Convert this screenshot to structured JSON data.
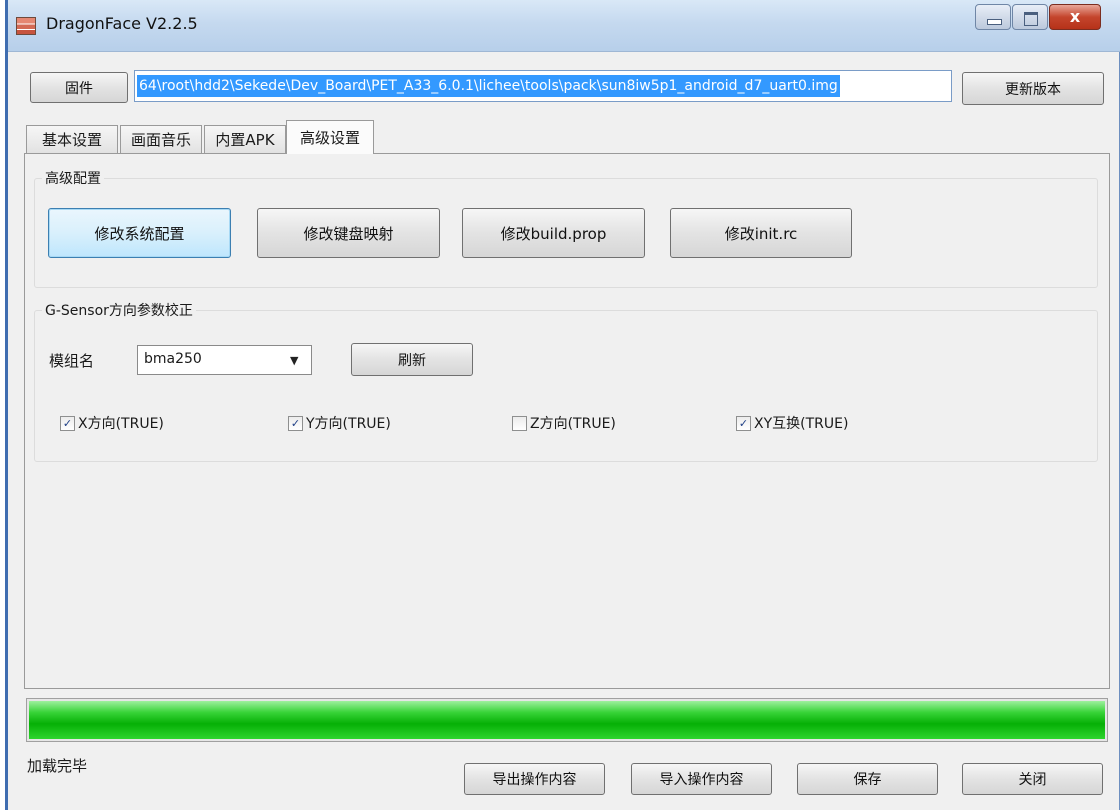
{
  "window": {
    "title": "DragonFace V2.2.5",
    "close_glyph": "x"
  },
  "top": {
    "firmware_label": "固件",
    "path_value": "64\\root\\hdd2\\Sekede\\Dev_Board\\PET_A33_6.0.1\\lichee\\tools\\pack\\sun8iw5p1_android_d7_uart0.img",
    "update_label": "更新版本"
  },
  "tabs": [
    "基本设置",
    "画面音乐",
    "内置APK",
    "高级设置"
  ],
  "advanced": {
    "group_title": "高级配置",
    "buttons": [
      "修改系统配置",
      "修改键盘映射",
      "修改build.prop",
      "修改init.rc"
    ]
  },
  "gsensor": {
    "group_title": "G-Sensor方向参数校正",
    "module_label": "模组名",
    "module_value": "bma250",
    "refresh_label": "刷新",
    "checkboxes": [
      {
        "label": "X方向(TRUE)",
        "checked": true
      },
      {
        "label": "Y方向(TRUE)",
        "checked": true
      },
      {
        "label": "Z方向(TRUE)",
        "checked": false
      },
      {
        "label": "XY互换(TRUE)",
        "checked": true
      }
    ]
  },
  "progress": {
    "fraction": 1.0,
    "color": "#06b006"
  },
  "status_text": "加载完毕",
  "bottom_buttons": {
    "export": "导出操作内容",
    "import": "导入操作内容",
    "save": "保存",
    "close": "关闭"
  }
}
